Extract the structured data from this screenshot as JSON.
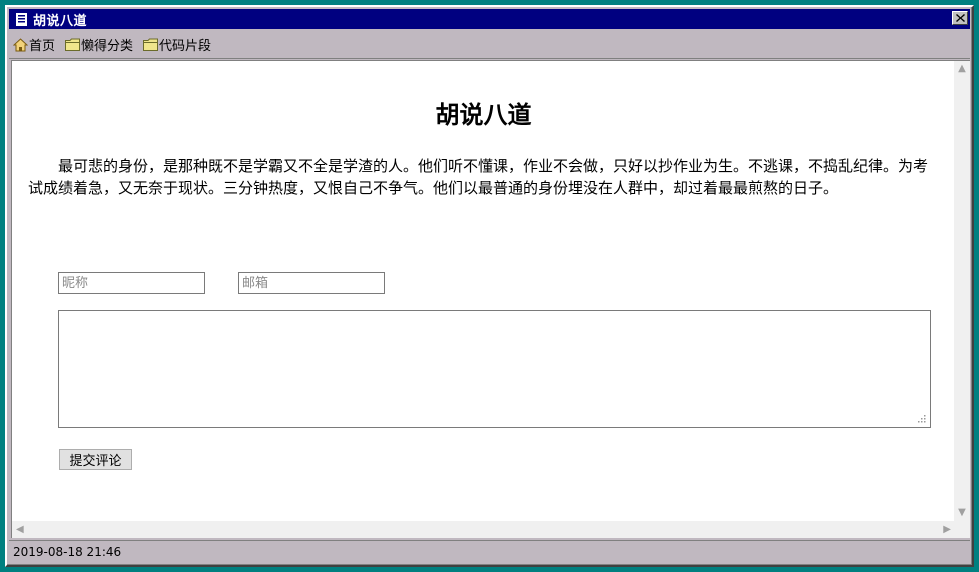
{
  "window": {
    "title": "胡说八道",
    "close_glyph": "×"
  },
  "menubar": {
    "items": [
      {
        "label": "首页",
        "icon": "home-icon"
      },
      {
        "label": "懒得分类",
        "icon": "folder-icon"
      },
      {
        "label": "代码片段",
        "icon": "folder-icon"
      }
    ]
  },
  "page": {
    "title": "胡说八道",
    "body": "最可悲的身份，是那种既不是学霸又不全是学渣的人。他们听不懂课，作业不会做，只好以抄作业为生。不逃课，不捣乱纪律。为考试成绩着急，又无奈于现状。三分钟热度，又恨自己不争气。他们以最普通的身份埋没在人群中，却过着最最煎熬的日子。"
  },
  "comment_form": {
    "nickname_placeholder": "昵称",
    "email_placeholder": "邮箱",
    "comment_value": "",
    "submit_label": "提交评论"
  },
  "statusbar": {
    "timestamp": "2019-08-18 21:46"
  },
  "colors": {
    "titlebar": "#000080",
    "desktop": "#008080",
    "chrome": "#c0b8c0"
  }
}
